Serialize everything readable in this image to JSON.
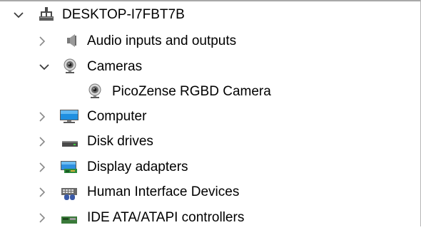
{
  "window": {
    "accent": "#0078d7",
    "text_color": "#000000",
    "chevron_color": "#6d6d6d"
  },
  "tree": {
    "root": {
      "label": "DESKTOP-I7FBT7B",
      "icon": "computer-network-icon",
      "expanded": true
    },
    "audio": {
      "label": "Audio inputs and outputs",
      "icon": "speaker-icon",
      "expanded": false
    },
    "cameras": {
      "label": "Cameras",
      "icon": "webcam-icon",
      "expanded": true
    },
    "camera_device": {
      "label": "PicoZense RGBD Camera",
      "icon": "webcam-icon"
    },
    "computer": {
      "label": "Computer",
      "icon": "monitor-icon",
      "expanded": false
    },
    "disk": {
      "label": "Disk drives",
      "icon": "disk-drive-icon",
      "expanded": false
    },
    "display": {
      "label": "Display adapters",
      "icon": "display-adapter-icon",
      "expanded": false
    },
    "hid": {
      "label": "Human Interface Devices",
      "icon": "hid-icon",
      "expanded": false
    },
    "ide": {
      "label": "IDE ATA/ATAPI controllers",
      "icon": "ide-controller-icon",
      "expanded": false
    }
  }
}
